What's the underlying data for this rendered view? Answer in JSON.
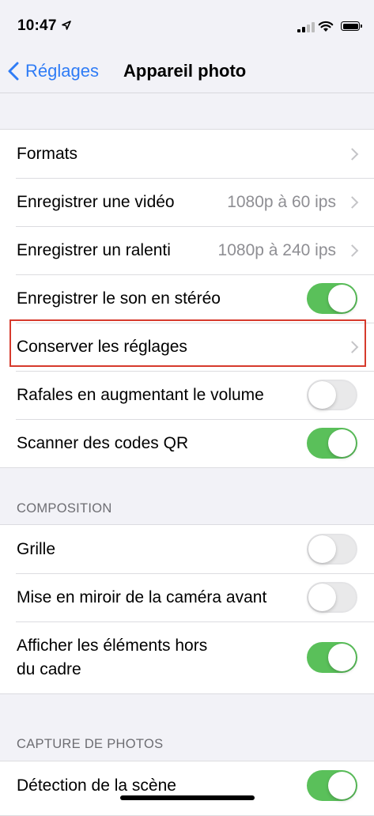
{
  "status_bar": {
    "time": "10:47"
  },
  "nav": {
    "back_label": "Réglages",
    "title": "Appareil photo"
  },
  "group1": {
    "rows": [
      {
        "label": "Formats",
        "value": "",
        "control": "chevron"
      },
      {
        "label": "Enregistrer une vidéo",
        "value": "1080p à 60 ips",
        "control": "chevron"
      },
      {
        "label": "Enregistrer un ralenti",
        "value": "1080p à 240 ips",
        "control": "chevron"
      },
      {
        "label": "Enregistrer le son en stéréo",
        "control": "toggle",
        "on": true
      },
      {
        "label": "Conserver les réglages",
        "control": "chevron"
      },
      {
        "label": "Rafales en augmentant le volume",
        "control": "toggle",
        "on": false
      },
      {
        "label": "Scanner des codes QR",
        "control": "toggle",
        "on": true
      }
    ]
  },
  "composition": {
    "header": "COMPOSITION",
    "rows": [
      {
        "label": "Grille",
        "control": "toggle",
        "on": false
      },
      {
        "label": "Mise en miroir de la caméra avant",
        "control": "toggle",
        "on": false
      },
      {
        "label": "Afficher les éléments hors\ndu cadre",
        "control": "toggle",
        "on": true
      }
    ]
  },
  "photo_capture": {
    "header": "CAPTURE DE PHOTOS",
    "rows": [
      {
        "label": "Détection de la scène",
        "control": "toggle",
        "on": true
      }
    ]
  },
  "colors": {
    "accent": "#2f7cf6",
    "toggle_on": "#5ac05a",
    "highlight": "#d63a2c"
  }
}
